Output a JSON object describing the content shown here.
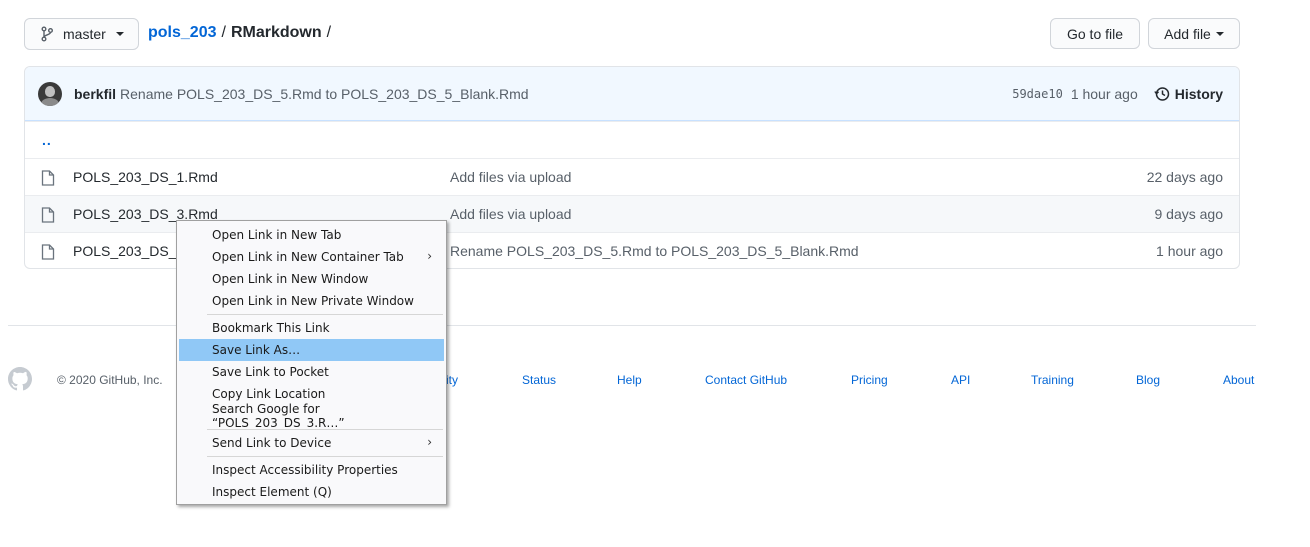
{
  "header": {
    "branch_label": "master",
    "repo": "pols_203",
    "sep1": "/",
    "dir": "RMarkdown",
    "sep2": "/",
    "goto_label": "Go to file",
    "addfile_label": "Add file"
  },
  "commit": {
    "author": "berkfil",
    "message": "Rename POLS_203_DS_5.Rmd to POLS_203_DS_5_Blank.Rmd",
    "sha": "59dae10",
    "age": "1 hour ago",
    "history_label": "History"
  },
  "files": {
    "parent": "..",
    "rows": [
      {
        "name": "POLS_203_DS_1.Rmd",
        "message": "Add files via upload",
        "age": "22 days ago"
      },
      {
        "name": "POLS_203_DS_3.Rmd",
        "message": "Add files via upload",
        "age": "9 days ago"
      },
      {
        "name": "POLS_203_DS_5_",
        "message": "Rename POLS_203_DS_5.Rmd to POLS_203_DS_5_Blank.Rmd",
        "age": "1 hour ago"
      }
    ]
  },
  "footer": {
    "copyright": "© 2020 GitHub, Inc.",
    "partial_link": "ity",
    "links": [
      "Status",
      "Help",
      "Contact GitHub",
      "Pricing",
      "API",
      "Training",
      "Blog",
      "About"
    ]
  },
  "context_menu": {
    "items": [
      "Open Link in New Tab",
      "Open Link in New Container Tab",
      "Open Link in New Window",
      "Open Link in New Private Window",
      "Bookmark This Link",
      "Save Link As…",
      "Save Link to Pocket",
      "Copy Link Location",
      "Search Google for “POLS_203_DS_3.R…”",
      "Send Link to Device",
      "Inspect Accessibility Properties",
      "Inspect Element (Q)"
    ],
    "active_item": "Save Link As…"
  },
  "colors": {
    "link": "#0366d6",
    "commit_bar_bg": "#f1f8ff",
    "menu_highlight": "#90c8f6"
  }
}
